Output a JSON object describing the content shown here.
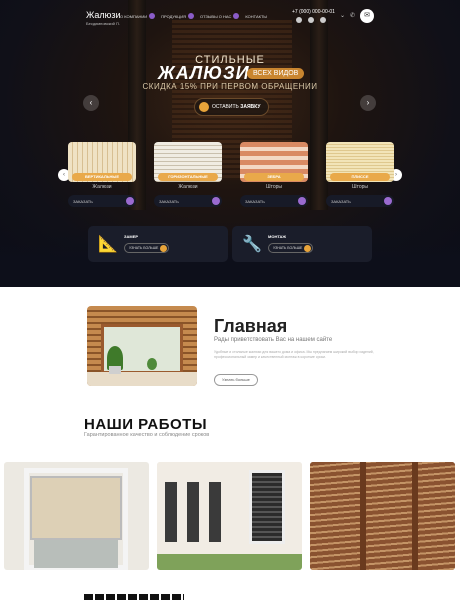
{
  "header": {
    "logo_title": "Жалюзи",
    "logo_subtitle": "Бесдимповский П.",
    "nav": [
      {
        "label": "О КОМПАНИИ",
        "icon": "menu-dot-icon"
      },
      {
        "label": "ПРОДУКЦИЯ",
        "icon": "menu-dot-icon"
      },
      {
        "label": "ОТЗЫВЫ О НАС",
        "icon": "menu-dot-icon"
      },
      {
        "label": "КОНТАКТЫ",
        "icon": "menu-dot-icon"
      }
    ],
    "phone": "+7 (000) 000-00-01",
    "icons": [
      "telegram-icon",
      "viber-icon",
      "whatsapp-icon",
      "chevron-down-icon",
      "phone-icon",
      "mail-icon"
    ]
  },
  "hero": {
    "kicker": "СТИЛЬНЫЕ",
    "title": "ЖАЛЮЗИ",
    "badge": "ВСЕХ ВИДОВ",
    "subtitle": "СКИДКА 15% ПРИ ПЕРВОМ ОБРАЩЕНИИ",
    "cta_prefix": "ОСТАВИТЬ",
    "cta_bold": "ЗАЯВКУ",
    "accent": "#e8a43a"
  },
  "products": [
    {
      "badge": "ВЕРТИКАЛЬНЫЕ",
      "sub": "Жалюзи",
      "button": "ЗАКАЗАТЬ"
    },
    {
      "badge": "ГОРИЗОНТАЛЬНЫЕ",
      "sub": "Жалюзи",
      "button": "ЗАКАЗАТЬ"
    },
    {
      "badge": "ЗЕБРА",
      "sub": "Шторы",
      "button": "ЗАКАЗАТЬ"
    },
    {
      "badge": "ПЛИССЕ",
      "sub": "Шторы",
      "button": "ЗАКАЗАТЬ"
    }
  ],
  "services": [
    {
      "title": "ЗАМЕР",
      "button": "УЗНАТЬ БОЛЬШЕ",
      "icon": "measure-icon"
    },
    {
      "title": "МОНТАЖ",
      "button": "УЗНАТЬ БОЛЬШЕ",
      "icon": "drill-icon"
    }
  ],
  "about": {
    "title": "Главная",
    "subtitle": "Рады приветствовать Вас на нашем сайте",
    "text": "Удобные и стильные жалюзи для вашего дома и офиса. Мы предлагаем широкий выбор изделий, профессиональный замер и качественный монтаж в короткие сроки.",
    "button": "Узнать больше"
  },
  "works": {
    "title": "НАШИ РАБОТЫ",
    "subtitle": "Гарантированное качество и соблюдение сроков"
  },
  "colors": {
    "hero_bg": "#0b0d16",
    "accent": "#e8a43a",
    "purple": "#9a6ad0"
  }
}
